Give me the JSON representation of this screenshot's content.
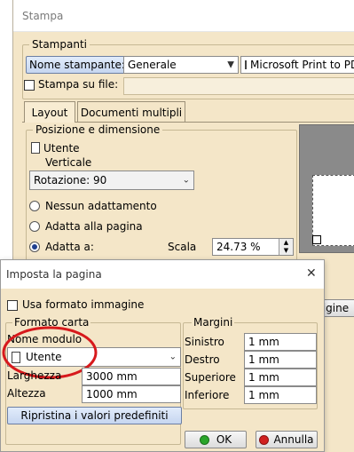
{
  "print_window": {
    "title": "Stampa",
    "printers_group": "Stampanti",
    "printer_name_button": "Nome stampante:",
    "printer_category": "Generale",
    "printer_device": "Microsoft Print to PDF",
    "print_to_file_label": "Stampa su file:",
    "print_to_file_value": "",
    "tabs": [
      {
        "label": "Layout"
      },
      {
        "label": "Documenti multipli"
      }
    ],
    "position_group": "Posizione e dimensione",
    "orientation_user": "Utente",
    "orientation": "Verticale",
    "rotation_value": "Rotazione: 90",
    "options": [
      {
        "label": "Nessun adattamento",
        "selected": false
      },
      {
        "label": "Adatta alla pagina",
        "selected": false
      },
      {
        "label": "Adatta a:",
        "selected": true
      }
    ],
    "scale_label": "Scala",
    "scale_value": "24.73 %",
    "origin_button_partial": "rigine"
  },
  "page_setup_dialog": {
    "title": "Imposta la pagina",
    "close_glyph": "✕",
    "use_image_format_label": "Usa formato immagine",
    "use_image_format_checked": false,
    "paper_group": "Formato carta",
    "form_name_label": "Nome modulo",
    "form_name_value": "Utente",
    "width_label": "Larghezza",
    "width_value": "3000 mm",
    "height_label": "Altezza",
    "height_value": "1000 mm",
    "reset_button": "Ripristina i valori predefiniti",
    "margins_group": "Margini",
    "margins": [
      {
        "label": "Sinistro",
        "value": "1 mm"
      },
      {
        "label": "Destro",
        "value": "1 mm"
      },
      {
        "label": "Superiore",
        "value": "1 mm"
      },
      {
        "label": "Inferiore",
        "value": "1 mm"
      }
    ],
    "ok_button": "OK",
    "cancel_button": "Annulla"
  },
  "colors": {
    "dialog_background": "#f4e6c8",
    "highlight_ring": "#d7191c",
    "ok_icon": "#2aa52a",
    "cancel_icon": "#d12020"
  }
}
